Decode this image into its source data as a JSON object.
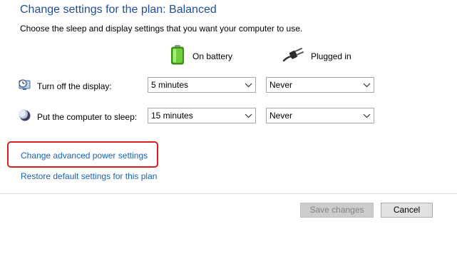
{
  "header": {
    "title": "Change settings for the plan: Balanced",
    "subtitle": "Choose the sleep and display settings that you want your computer to use."
  },
  "columns": {
    "battery": {
      "label": "On battery",
      "icon": "battery-icon"
    },
    "plugged": {
      "label": "Plugged in",
      "icon": "plug-icon"
    }
  },
  "settings": {
    "display": {
      "label": "Turn off the display:",
      "icon": "monitor-clock-icon",
      "on_battery": "5 minutes",
      "plugged_in": "Never"
    },
    "sleep": {
      "label": "Put the computer to sleep:",
      "icon": "moon-icon",
      "on_battery": "15 minutes",
      "plugged_in": "Never"
    }
  },
  "links": {
    "advanced": "Change advanced power settings",
    "restore": "Restore default settings for this plan"
  },
  "buttons": {
    "save": "Save changes",
    "cancel": "Cancel"
  },
  "colors": {
    "title": "#1e4f9c",
    "link": "#1664b8",
    "highlight_border": "#d81e1e",
    "battery_green": "#4caf1e"
  }
}
